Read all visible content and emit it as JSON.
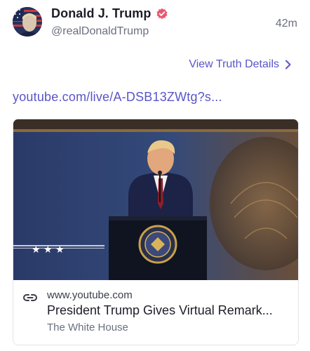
{
  "post": {
    "author_name": "Donald J. Trump",
    "handle": "@realDonaldTrump",
    "time": "42m",
    "details_link": "View Truth Details",
    "url_text": "youtube.com/live/A-DSB13ZWtg?s..."
  },
  "card": {
    "domain": "www.youtube.com",
    "title": "President Trump Gives Virtual Remark...",
    "source": "The White House"
  },
  "icons": {
    "verified": "verified-badge-icon",
    "chevron": "chevron-right-icon",
    "link": "link-icon"
  },
  "colors": {
    "accent": "#5a55c9",
    "verified": "#e8596f",
    "text": "#1d1d28",
    "muted": "#6b6f80"
  }
}
